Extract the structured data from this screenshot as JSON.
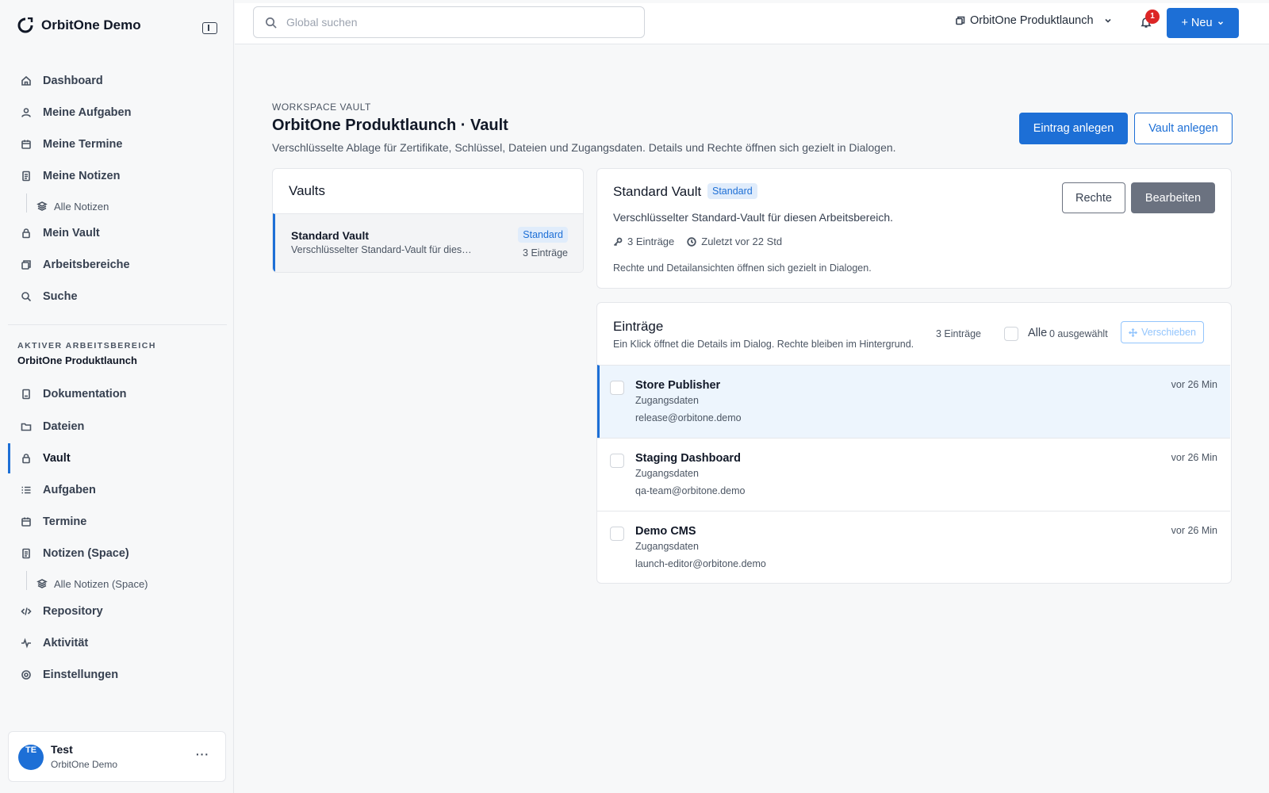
{
  "app": {
    "brand": "OrbitOne Demo"
  },
  "nav": {
    "main": [
      {
        "label": "Dashboard",
        "icon": "home-icon"
      },
      {
        "label": "Meine Aufgaben",
        "icon": "user-icon"
      },
      {
        "label": "Meine Termine",
        "icon": "calendar-icon"
      },
      {
        "label": "Meine Notizen",
        "icon": "note-icon"
      }
    ],
    "notes_sub": "Alle Notizen",
    "main2": [
      {
        "label": "Mein Vault",
        "icon": "lock-icon"
      },
      {
        "label": "Arbeitsbereiche",
        "icon": "layers-icon"
      },
      {
        "label": "Suche",
        "icon": "search-icon"
      }
    ],
    "workspace_label": "AKTIVER ARBEITSBEREICH",
    "workspace_name": "OrbitOne Produktlaunch",
    "workspace": [
      {
        "label": "Dokumentation",
        "icon": "document-icon"
      },
      {
        "label": "Dateien",
        "icon": "folder-icon"
      },
      {
        "label": "Vault",
        "icon": "lock-icon",
        "active": true
      },
      {
        "label": "Aufgaben",
        "icon": "list-icon"
      },
      {
        "label": "Termine",
        "icon": "calendar-icon"
      },
      {
        "label": "Notizen (Space)",
        "icon": "note-icon"
      }
    ],
    "space_notes_sub": "Alle Notizen (Space)",
    "workspace2": [
      {
        "label": "Repository",
        "icon": "code-icon"
      },
      {
        "label": "Aktivität",
        "icon": "activity-icon"
      },
      {
        "label": "Einstellungen",
        "icon": "settings-icon"
      }
    ]
  },
  "user": {
    "initials": "TE",
    "name": "Test",
    "org": "OrbitOne Demo",
    "more": "···"
  },
  "topbar": {
    "search_placeholder": "Global suchen",
    "workspace": "OrbitOne Produktlaunch",
    "notifications": "1",
    "new_label": "+ Neu"
  },
  "header": {
    "eyebrow": "WORKSPACE VAULT",
    "title": "OrbitOne Produktlaunch · Vault",
    "description": "Verschlüsselte Ablage für Zertifikate, Schlüssel, Dateien und Zugangsdaten. Details und Rechte öffnen sich gezielt in Dialogen.",
    "add_entry": "Eintrag anlegen",
    "add_vault": "Vault anlegen"
  },
  "vaults": {
    "heading": "Vaults",
    "items": [
      {
        "name": "Standard Vault",
        "description": "Verschlüsselter Standard-Vault für diesen Arbeitsbereich.",
        "badge": "Standard",
        "count": "3 Einträge"
      }
    ]
  },
  "detail": {
    "title": "Standard Vault",
    "badge": "Standard",
    "description": "Verschlüsselter Standard-Vault für diesen Arbeitsbereich.",
    "entries": "3 Einträge",
    "updated": "Zuletzt vor 22 Std",
    "note": "Rechte und Detailansichten öffnen sich gezielt in Dialogen.",
    "rights": "Rechte",
    "edit": "Bearbeiten"
  },
  "entries": {
    "title": "Einträge",
    "subtitle": "Ein Klick öffnet die Details im Dialog. Rechte bleiben im Hintergrund.",
    "count": "3 Einträge",
    "all": "Alle",
    "selected": "0 ausgewählt",
    "move": "Verschieben",
    "items": [
      {
        "name": "Store Publisher",
        "type": "Zugangsdaten",
        "user": "release@orbitone.demo",
        "time": "vor 26 Min"
      },
      {
        "name": "Staging Dashboard",
        "type": "Zugangsdaten",
        "user": "qa-team@orbitone.demo",
        "time": "vor 26 Min"
      },
      {
        "name": "Demo CMS",
        "type": "Zugangsdaten",
        "user": "launch-editor@orbitone.demo",
        "time": "vor 26 Min"
      }
    ]
  },
  "colors": {
    "accent": "#1d6fd6",
    "badge_bg": "#e0ecfb",
    "danger": "#dc2626",
    "selected_row": "#edf5fd"
  }
}
